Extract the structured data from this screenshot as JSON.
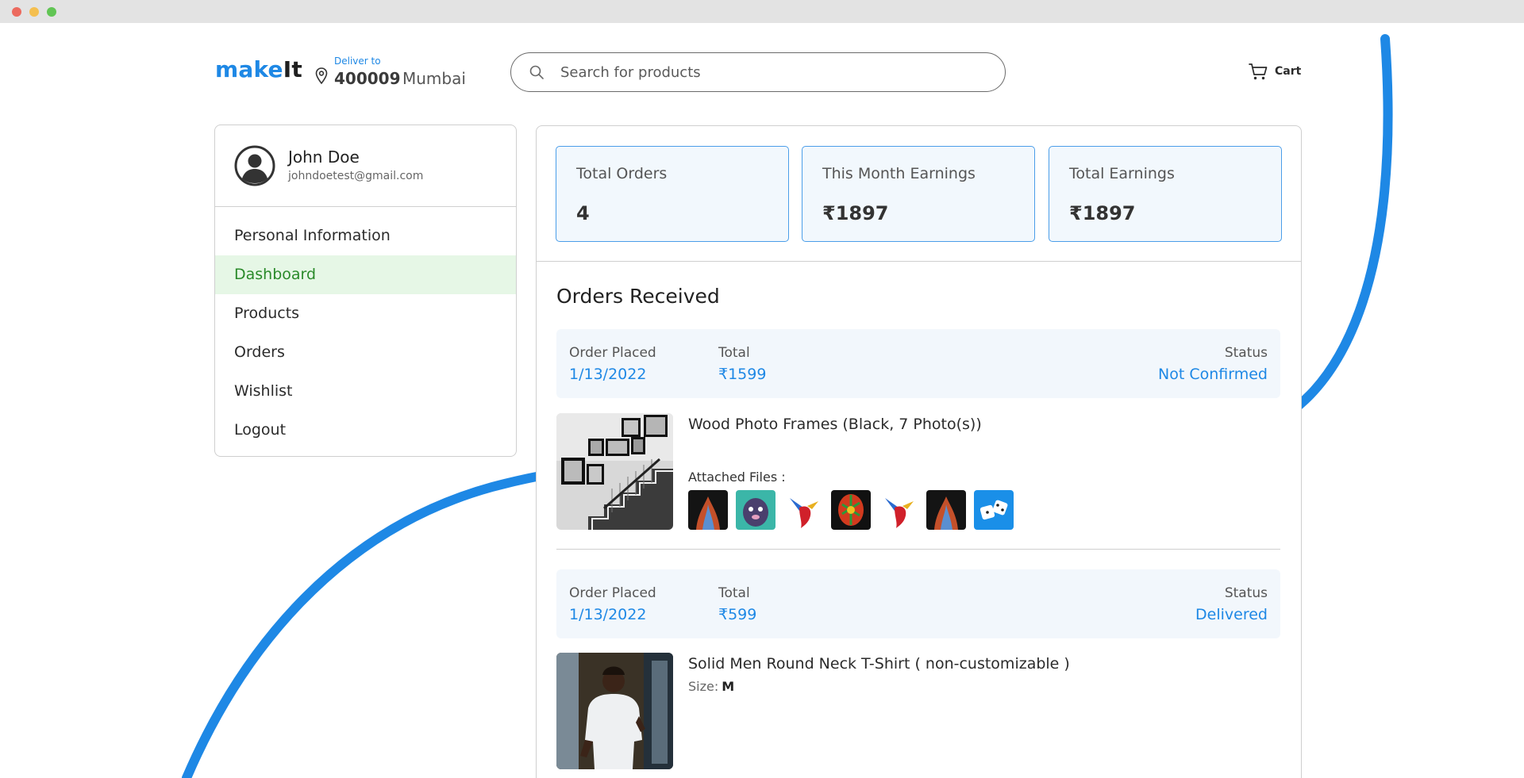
{
  "header": {
    "logo_part1": "make",
    "logo_part2": "It",
    "deliver_label": "Deliver to",
    "pincode": "400009",
    "city": "Mumbai",
    "search_placeholder": "Search for products",
    "cart_label": "Cart"
  },
  "sidebar": {
    "user_name": "John Doe",
    "user_email": "johndoetest@gmail.com",
    "items": [
      {
        "label": "Personal Information",
        "active": false
      },
      {
        "label": "Dashboard",
        "active": true
      },
      {
        "label": "Products",
        "active": false
      },
      {
        "label": "Orders",
        "active": false
      },
      {
        "label": "Wishlist",
        "active": false
      },
      {
        "label": "Logout",
        "active": false
      }
    ]
  },
  "stats": [
    {
      "label": "Total Orders",
      "value": "4"
    },
    {
      "label": "This Month Earnings",
      "value": "₹1897"
    },
    {
      "label": "Total Earnings",
      "value": "₹1897"
    }
  ],
  "orders_title": "Orders Received",
  "orders": [
    {
      "placed_label": "Order Placed",
      "placed": "1/13/2022",
      "total_label": "Total",
      "total": "₹1599",
      "status_label": "Status",
      "status": "Not Confirmed",
      "product_title": "Wood Photo Frames (Black, 7 Photo(s))",
      "attached_label": "Attached Files :",
      "attached_files": [
        "fire-art-thumb",
        "dog-art-thumb",
        "hummingbird-thumb",
        "color-art-thumb",
        "hummingbird-thumb",
        "fire-art-thumb",
        "dice-thumb"
      ]
    },
    {
      "placed_label": "Order Placed",
      "placed": "1/13/2022",
      "total_label": "Total",
      "total": "₹599",
      "status_label": "Status",
      "status": "Delivered",
      "product_title": "Solid Men Round Neck T-Shirt ( non-customizable )",
      "size_label": "Size:",
      "size": "M"
    }
  ],
  "colors": {
    "accent": "#1e88e5",
    "active_bg": "#e6f7e6",
    "active_text": "#2a8a2a",
    "card_border": "#4b9ee9",
    "card_bg": "#f2f8fd"
  }
}
